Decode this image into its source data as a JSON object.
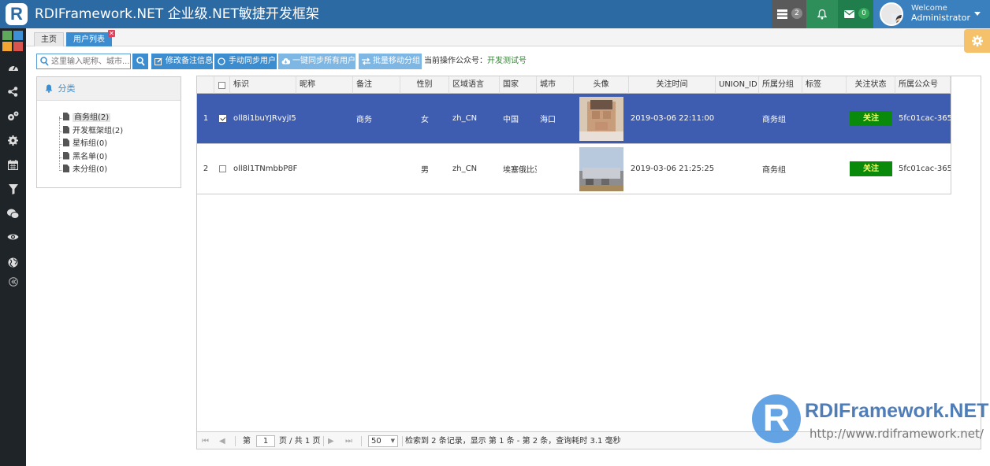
{
  "app": {
    "logo_letter": "R",
    "title": "RDIFramework.NET 企业级.NET敏捷开发框架"
  },
  "topbar": {
    "tasks_count": "2",
    "mail_count": "0",
    "welcome": "Welcome",
    "username": "Administrator",
    "colors": {
      "bar": "#2c6aa3",
      "tasks": "#5a5a5a",
      "bell": "#2f8f5a",
      "mail": "#1f7e4c",
      "user": "#3b80be"
    }
  },
  "sidebar": {
    "icons": [
      "dashboard-icon",
      "share-icon",
      "cogs-icon",
      "gear-icon",
      "calendar-icon",
      "filter-icon",
      "wechat-icon",
      "eye-icon",
      "globe-icon",
      "collapse-icon"
    ]
  },
  "tabs": [
    {
      "label": "主页"
    },
    {
      "label": "用户列表"
    }
  ],
  "toolbar": {
    "search_placeholder": "这里输入昵称、城市...",
    "edit_remark": "修改备注信息",
    "manual_sync": "手动同步用户",
    "sync_all": "一键同步所有用户",
    "batch_move": "批量移动分组",
    "current_account_label": "当前操作公众号：",
    "current_account_value": "开发测试号"
  },
  "category": {
    "title": "分类",
    "items": [
      {
        "label": "商务组(2)",
        "selected": true
      },
      {
        "label": "开发框架组(2)"
      },
      {
        "label": "星标组(0)"
      },
      {
        "label": "黑名单(0)"
      },
      {
        "label": "未分组(0)"
      }
    ]
  },
  "grid": {
    "columns": [
      "标识",
      "昵称",
      "备注",
      "性别",
      "区域语言",
      "国家",
      "城市",
      "头像",
      "关注时间",
      "UNION_ID",
      "所属分组",
      "标签",
      "关注状态",
      "所属公众号"
    ],
    "rows": [
      {
        "num": "1",
        "checked": true,
        "id": "oll8i1buYJRvyjI5",
        "nickname": "",
        "remark": "商务",
        "gender": "女",
        "lang": "zh_CN",
        "country": "中国",
        "city": "海口",
        "avatar": "face-photo",
        "time": "2019-03-06 22:11:00",
        "union_id": "",
        "group": "商务组",
        "tags": "",
        "status": "关注",
        "account": "5fc01cac-365"
      },
      {
        "num": "2",
        "checked": false,
        "id": "oll8l1TNmbbP8F",
        "nickname": "",
        "remark": "",
        "gender": "男",
        "lang": "zh_CN",
        "country": "埃塞俄比亚",
        "city": "",
        "avatar": "building-photo",
        "time": "2019-03-06 21:25:25",
        "union_id": "",
        "group": "商务组",
        "tags": "",
        "status": "关注",
        "account": "5fc01cac-365"
      }
    ]
  },
  "pager": {
    "page_label": "第",
    "page": "1",
    "page_total": "页 / 共 1 页",
    "page_size": "50",
    "summary": "检索到 2 条记录，显示 第 1 条 - 第 2 条，查询耗时 3.1 毫秒"
  },
  "watermark": {
    "letter": "R",
    "title": "RDIFramework.NET",
    "url": "http://www.rdiframework.net/"
  }
}
